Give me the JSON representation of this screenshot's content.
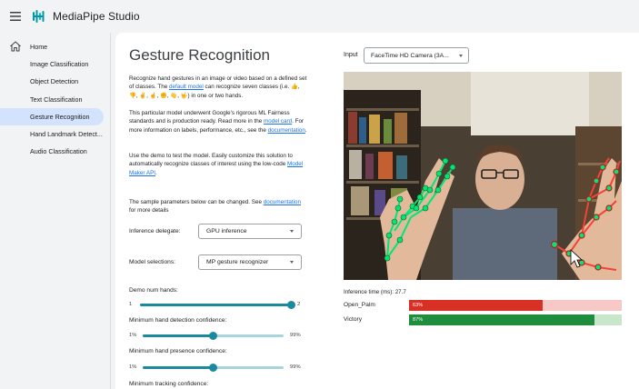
{
  "app": {
    "title": "MediaPipe Studio"
  },
  "sidebar": {
    "items": [
      {
        "label": "Home"
      },
      {
        "label": "Image Classification"
      },
      {
        "label": "Object Detection"
      },
      {
        "label": "Text Classification"
      },
      {
        "label": "Gesture Recognition",
        "active": true
      },
      {
        "label": "Hand Landmark Detect..."
      },
      {
        "label": "Audio Classification"
      }
    ]
  },
  "main": {
    "title": "Gesture Recognition",
    "intro": {
      "text_before": "Recognize hand gestures in an image or video based on a defined set of classes. The ",
      "link": "default model",
      "text_after": " can recognize seven classes (i.e. 👍, 👎, ✌️, ☝️, ✊, 👋, 🤟) in one or two hands."
    },
    "model_info": {
      "text_before": "This particular model underwent Google's rigorous ML Fairness standards and is production ready. Read more in the ",
      "link1": "model card",
      "text_middle": ". For more information on labels, performance, etc., see the ",
      "link2": "documentation",
      "text_after": "."
    },
    "demo_info": {
      "text_before": "Use the demo to test the model. Easily customize this solution to automatically recognize classes of interest using the low-code ",
      "link": "Model Maker API",
      "text_after": "."
    },
    "params_info": {
      "text_before": "The sample parameters below can be changed. See ",
      "link": "documentation",
      "text_after": " for more details"
    },
    "inference_delegate": {
      "label": "Inference delegate:",
      "value": "GPU inference"
    },
    "model_selection": {
      "label": "Model selections:",
      "value": "MP gesture recognizer"
    },
    "sliders": [
      {
        "label": "Demo num hands:",
        "min": "1",
        "max": "2",
        "fraction": 1.0
      },
      {
        "label": "Minimum hand detection confidence:",
        "min": "1%",
        "max": "99%",
        "fraction": 0.5
      },
      {
        "label": "Minimum hand presence confidence:",
        "min": "1%",
        "max": "99%",
        "fraction": 0.5
      },
      {
        "label": "Minimum tracking confidence:"
      }
    ]
  },
  "preview": {
    "input_label": "Input",
    "camera": "FaceTime HD Camera (3A...",
    "inference_time": "Inference time (ms): 27.7",
    "results": [
      {
        "name": "Open_Palm",
        "percent": "63%",
        "fraction": 0.63,
        "color": "#d93025",
        "bg": "#f6c9c6"
      },
      {
        "name": "Victory",
        "percent": "87%",
        "fraction": 0.87,
        "color": "#1e8e3e",
        "bg": "#c8e6c9"
      }
    ]
  },
  "colors": {
    "accent": "#1b8a9c",
    "link": "#1a73e8",
    "active_nav": "#d3e3fd"
  }
}
